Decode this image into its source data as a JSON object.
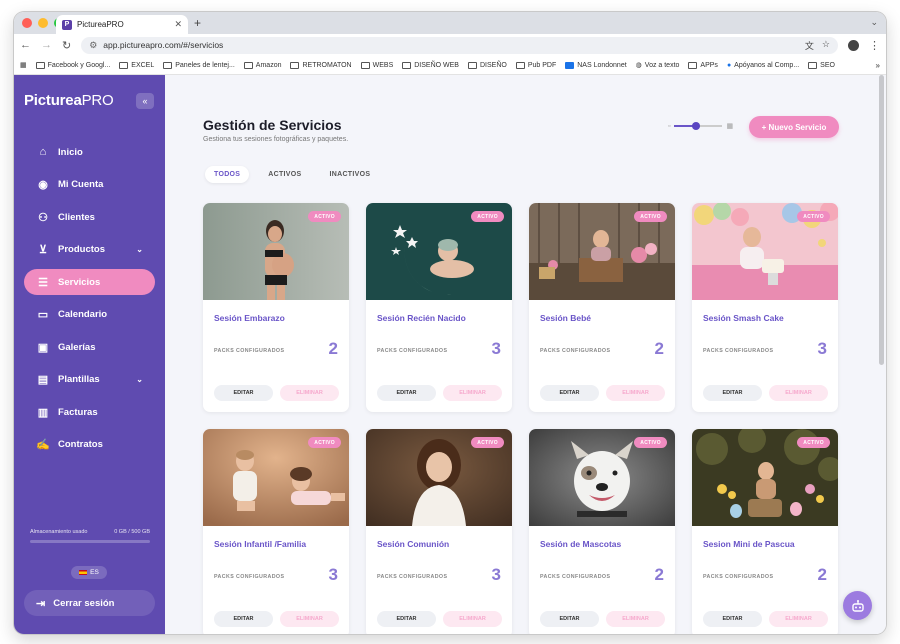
{
  "browser": {
    "tab_title": "PictureaPRO",
    "favicon_letter": "P",
    "url": "app.pictureapro.com/#/servicios",
    "bookmarks": [
      "Facebook y Googl...",
      "EXCEL",
      "Paneles de lentej...",
      "Amazon",
      "RETROMATON",
      "WEBS",
      "DISEÑO WEB",
      "DISEÑO",
      "Pub PDF",
      "NAS Londonnet",
      "Voz a texto",
      "APPs",
      "Apóyanos al Comp...",
      "SEO"
    ],
    "traffic_colors": [
      "#ff5f57",
      "#febc2e",
      "#28c840"
    ]
  },
  "sidebar": {
    "logo_main": "Picturea",
    "logo_suffix": "PRO",
    "items": [
      {
        "label": "Inicio",
        "icon": "home-icon"
      },
      {
        "label": "Mi Cuenta",
        "icon": "account-icon"
      },
      {
        "label": "Clientes",
        "icon": "user-plus-icon"
      },
      {
        "label": "Productos",
        "icon": "cart-icon"
      },
      {
        "label": "Servicios",
        "icon": "menu-icon"
      },
      {
        "label": "Calendario",
        "icon": "calendar-icon"
      },
      {
        "label": "Galerías",
        "icon": "gallery-icon"
      },
      {
        "label": "Plantillas",
        "icon": "template-icon"
      },
      {
        "label": "Facturas",
        "icon": "invoice-icon"
      },
      {
        "label": "Contratos",
        "icon": "contract-icon"
      }
    ],
    "active_index": 4,
    "storage_label": "Almacenamiento usado",
    "storage_value": "0 GB / 500 GB",
    "storage_fraction": 0,
    "language": "ES",
    "logout_label": "Cerrar sesión"
  },
  "main": {
    "title": "Gestión de Servicios",
    "subtitle": "Gestiona tus sesiones fotográficas y paquetes.",
    "new_button": "+ Nuevo Servicio",
    "zoom_fraction": 0.45,
    "filters": [
      "TODOS",
      "ACTIVOS",
      "INACTIVOS"
    ],
    "active_filter": 0,
    "packs_label": "PACKS CONFIGURADOS",
    "edit_label": "EDITAR",
    "delete_label": "ELIMINAR",
    "services": [
      {
        "name": "Sesión Embarazo",
        "packs": "2",
        "status": "ACTIVO",
        "photo": "pregnancy"
      },
      {
        "name": "Sesión Recién Nacido",
        "packs": "3",
        "status": "ACTIVO",
        "photo": "newborn"
      },
      {
        "name": "Sesión Bebé",
        "packs": "2",
        "status": "ACTIVO",
        "photo": "baby"
      },
      {
        "name": "Sesión Smash Cake",
        "packs": "3",
        "status": "ACTIVO",
        "photo": "smash-cake"
      },
      {
        "name": "Sesión Infantil /Familia",
        "packs": "3",
        "status": "ACTIVO",
        "photo": "kids"
      },
      {
        "name": "Sesión Comunión",
        "packs": "3",
        "status": "ACTIVO",
        "photo": "communion"
      },
      {
        "name": "Sesión de Mascotas",
        "packs": "2",
        "status": "ACTIVO",
        "photo": "dog"
      },
      {
        "name": "Sesion Mini de Pascua",
        "packs": "2",
        "status": "ACTIVO",
        "photo": "easter"
      }
    ]
  },
  "colors": {
    "sidebar_bg": "#5f4bb0",
    "accent_pink": "#f08bc0",
    "accent_purple": "#6a55c8"
  }
}
